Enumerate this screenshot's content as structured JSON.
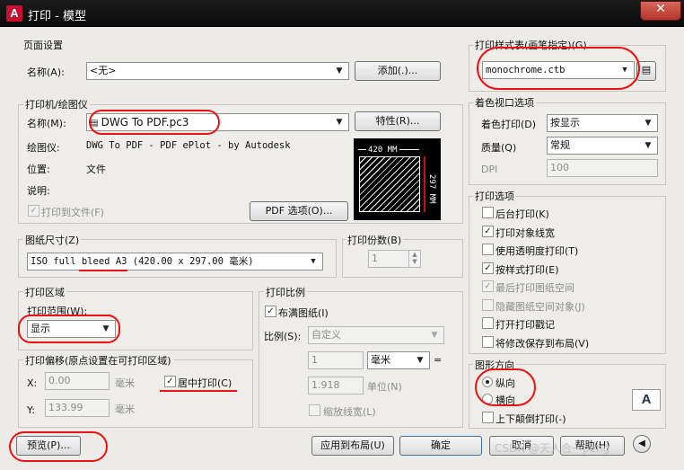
{
  "window": {
    "title": "打印 - 模型",
    "app_icon": "A",
    "close_icon": "✕"
  },
  "page_setup": {
    "group": "页面设置",
    "name_label": "名称(A):",
    "name_value": "<无>",
    "add_button": "添加(.)..."
  },
  "printer": {
    "group": "打印机/绘图仪",
    "name_label": "名称(M):",
    "name_value": "DWG To PDF.pc3",
    "properties_button": "特性(R)...",
    "plotter_label": "绘图仪:",
    "plotter_value": "DWG To PDF - PDF ePlot - by Autodesk",
    "location_label": "位置:",
    "location_value": "文件",
    "description_label": "说明:",
    "print_to_file": "打印到文件(F)",
    "pdf_options_button": "PDF 选项(O)...",
    "preview_width": "420 MM",
    "preview_height": "297 MM"
  },
  "paper_size": {
    "group": "图纸尺寸(Z)",
    "value": "ISO full bleed A3 (420.00 x 297.00 毫米)"
  },
  "copies": {
    "group": "打印份数(B)",
    "value": "1"
  },
  "plot_area": {
    "group": "打印区域",
    "range_label": "打印范围(W):",
    "range_value": "显示"
  },
  "plot_offset": {
    "group": "打印偏移(原点设置在可打印区域)",
    "x_label": "X:",
    "x_value": "0.00",
    "x_unit": "毫米",
    "y_label": "Y:",
    "y_value": "133.99",
    "y_unit": "毫米",
    "center": "居中打印(C)"
  },
  "plot_scale": {
    "group": "打印比例",
    "fit": "布满图纸(I)",
    "scale_label": "比例(S):",
    "scale_value": "自定义",
    "value1": "1",
    "unit1": "毫米",
    "equals": "=",
    "value2": "1.918",
    "unit2": "单位(N)",
    "scale_lineweights": "缩放线宽(L)"
  },
  "plot_style": {
    "group": "打印样式表(画笔指定)(G)",
    "value": "monochrome.ctb"
  },
  "shaded_viewport": {
    "group": "着色视口选项",
    "shade_label": "着色打印(D)",
    "shade_value": "按显示",
    "quality_label": "质量(Q)",
    "quality_value": "常规",
    "dpi_label": "DPI",
    "dpi_value": "100"
  },
  "plot_options": {
    "group": "打印选项",
    "items": [
      {
        "label": "后台打印(K)",
        "checked": false,
        "disabled": false
      },
      {
        "label": "打印对象线宽",
        "checked": true,
        "disabled": false
      },
      {
        "label": "使用透明度打印(T)",
        "checked": false,
        "disabled": false
      },
      {
        "label": "按样式打印(E)",
        "checked": true,
        "disabled": false
      },
      {
        "label": "最后打印图纸空间",
        "checked": true,
        "disabled": true
      },
      {
        "label": "隐藏图纸空间对象(J)",
        "checked": false,
        "disabled": true
      },
      {
        "label": "打开打印戳记",
        "checked": false,
        "disabled": false
      },
      {
        "label": "将修改保存到布局(V)",
        "checked": false,
        "disabled": false
      }
    ]
  },
  "orientation": {
    "group": "图形方向",
    "portrait": "纵向",
    "landscape": "横向",
    "upside_down": "上下颠倒打印(-)",
    "icon": "A"
  },
  "footer": {
    "preview": "预览(P)...",
    "apply": "应用到布局(U)",
    "ok": "确定",
    "cancel": "取消",
    "help": "帮助(H)",
    "collapse_icon": "◀",
    "watermark": "CSDN @天人合一peng"
  }
}
